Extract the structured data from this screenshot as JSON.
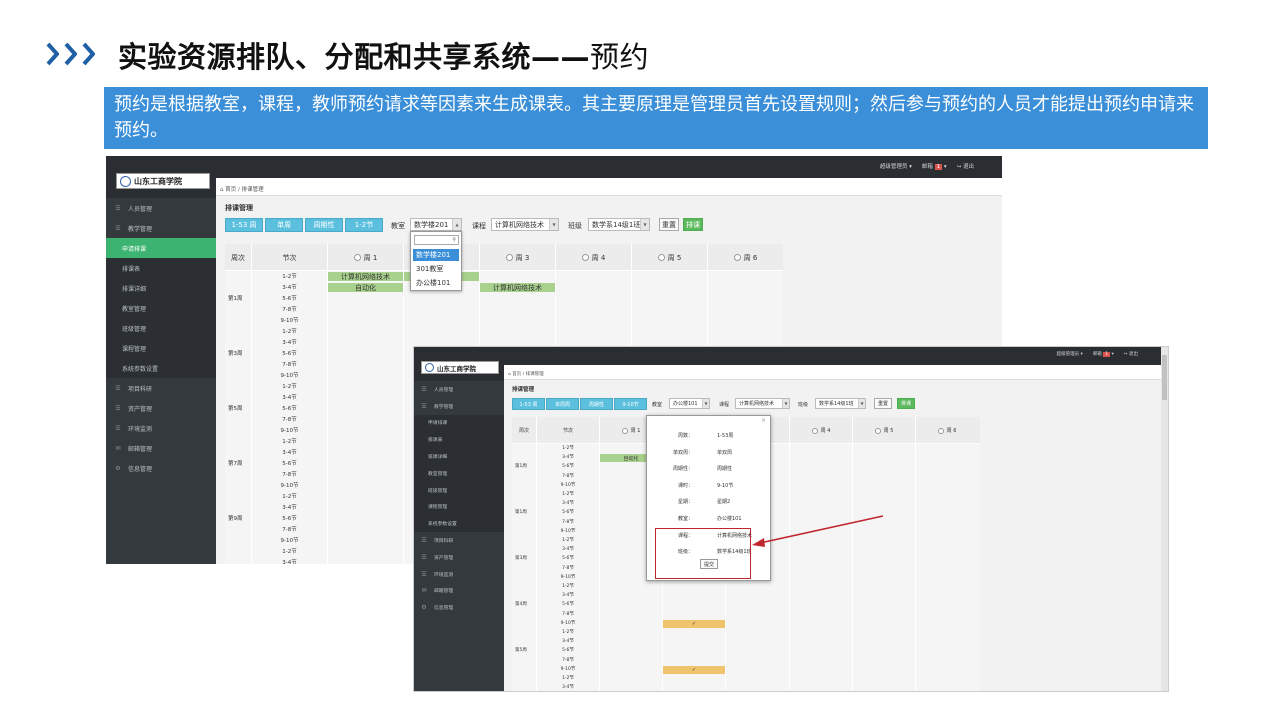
{
  "slide": {
    "title_bold": "实验资源排队、分配和共享系统——",
    "title_thin": "预约",
    "description": "预约是根据教室，课程，教师预约请求等因素来生成课表。其主要原理是管理员首先设置规则；然后参与预约的人员才能提出预约申请来预约。",
    "accent_color": "#3a8fd8",
    "chevron_color": "#1f5fa6"
  },
  "app": {
    "logo_text": "山东工商学院",
    "topbar": {
      "admin": "超级管理员 ▾",
      "mail": "邮箱",
      "mail_count": "1",
      "logout": "退出"
    },
    "breadcrumb": "首页 / 排课管理",
    "panel_title": "排课管理",
    "sidebar": [
      {
        "label": "人员管理",
        "icon": "☰",
        "kind": "section"
      },
      {
        "label": "教学管理",
        "icon": "☰",
        "kind": "section"
      },
      {
        "label": "申请排课",
        "icon": "",
        "kind": "sub"
      },
      {
        "label": "排课表",
        "icon": "",
        "kind": "sub"
      },
      {
        "label": "排课详细",
        "icon": "",
        "kind": "sub"
      },
      {
        "label": "教室管理",
        "icon": "",
        "kind": "sub"
      },
      {
        "label": "班级管理",
        "icon": "",
        "kind": "sub"
      },
      {
        "label": "课程管理",
        "icon": "",
        "kind": "sub"
      },
      {
        "label": "系统参数设置",
        "icon": "",
        "kind": "sub"
      },
      {
        "label": "项目科研",
        "icon": "☰",
        "kind": "section"
      },
      {
        "label": "资产管理",
        "icon": "☰",
        "kind": "section"
      },
      {
        "label": "环境监测",
        "icon": "☰",
        "kind": "section"
      },
      {
        "label": "邮箱管理",
        "icon": "✉",
        "kind": "section"
      },
      {
        "label": "信息管理",
        "icon": "⚙",
        "kind": "section"
      }
    ],
    "tabs": [
      "1-53 周",
      "单周",
      "周期性",
      "1-2节"
    ],
    "tabs2": [
      "1-53 周",
      "单周周",
      "周期性",
      "9-10节"
    ],
    "classroom_label": "教室",
    "course_label": "课程",
    "class_label": "班级",
    "classroom_value_1": "数学楼201",
    "classroom_value_2": "办公楼101",
    "course_value": "计算机网络技术",
    "class_value": "数学系14级1班",
    "reset_button": "重置",
    "schedule_button": "排课",
    "grid_headers": [
      "周次",
      "节次",
      "周 1",
      "周 2",
      "周 3",
      "周 4",
      "周 5",
      "周 6"
    ],
    "sections": [
      "1-2节",
      "3-4节",
      "5-6节",
      "7-8节",
      "9-10节"
    ],
    "weeks": [
      "第1周",
      "第3周",
      "第5周",
      "第7周",
      "第9周"
    ],
    "weeks2": [
      "第1周",
      "第1周",
      "第3周",
      "第4周",
      "第5周"
    ],
    "green_1": "计算机网络技术",
    "green_2": "自动化",
    "green_3": "计算机网络技术",
    "dropdown_options": [
      "数学楼201",
      "301教室",
      "办公楼101"
    ],
    "modal": {
      "rows": [
        {
          "k": "周数：",
          "v": "1-53周"
        },
        {
          "k": "单双周：",
          "v": "单双周"
        },
        {
          "k": "周期性：",
          "v": "周期性"
        },
        {
          "k": "课时：",
          "v": "9-10节"
        },
        {
          "k": "星期：",
          "v": "星期2"
        },
        {
          "k": "教室：",
          "v": "办公楼101"
        },
        {
          "k": "课程：",
          "v": "计算机网络技术"
        },
        {
          "k": "班级：",
          "v": "数学系14级1班"
        }
      ],
      "submit": "提交",
      "close": "×",
      "check": "✓"
    }
  }
}
